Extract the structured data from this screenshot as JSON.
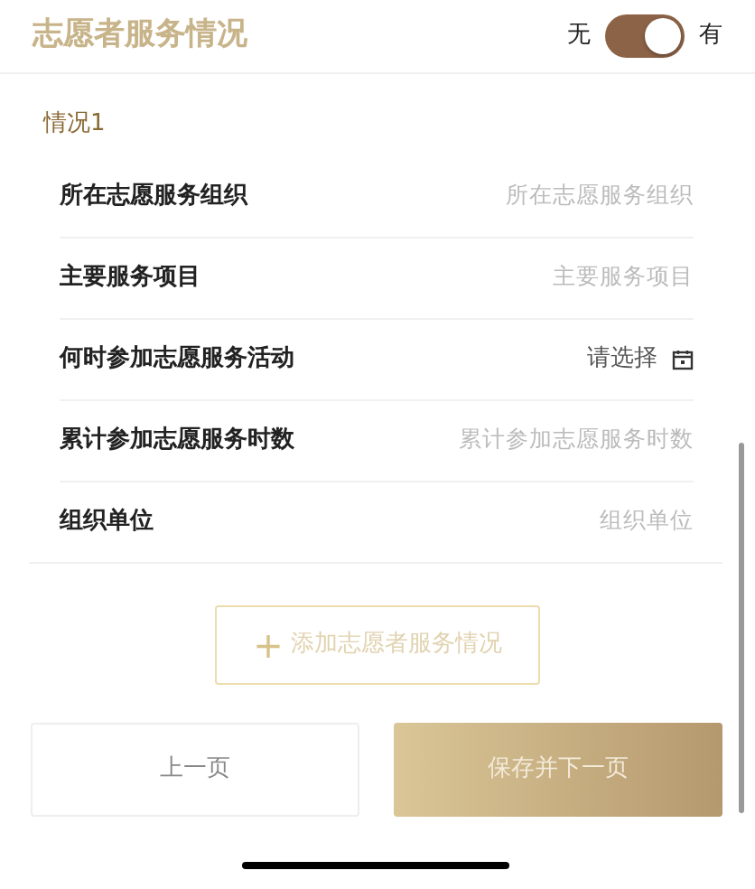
{
  "section": {
    "title": "志愿者服务情况",
    "toggle_off_label": "无",
    "toggle_on_label": "有",
    "on": true
  },
  "entry": {
    "title": "情况1",
    "fields": [
      {
        "kind": "text",
        "label": "所在志愿服务组织",
        "placeholder": "所在志愿服务组织"
      },
      {
        "kind": "text",
        "label": "主要服务项目",
        "placeholder": "主要服务项目"
      },
      {
        "kind": "date",
        "label": "何时参加志愿服务活动",
        "placeholder": "请选择"
      },
      {
        "kind": "text",
        "label": "累计参加志愿服务时数",
        "placeholder": "累计参加志愿服务时数"
      },
      {
        "kind": "text",
        "label": "组织单位",
        "placeholder": "组织单位"
      }
    ]
  },
  "add_button": {
    "icon": "+",
    "label": "添加志愿者服务情况"
  },
  "buttons": [
    {
      "label": "上一页",
      "kind": "secondary"
    },
    {
      "label": "保存并下一页",
      "kind": "primary"
    }
  ]
}
